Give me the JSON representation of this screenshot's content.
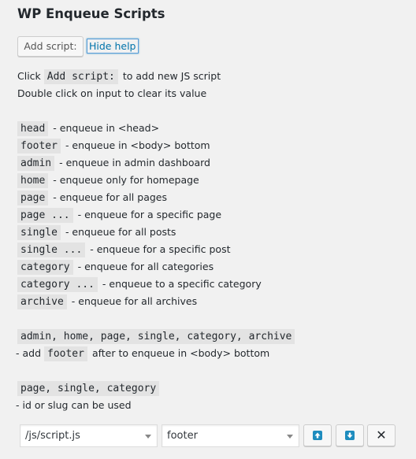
{
  "page": {
    "title": "WP Enqueue Scripts"
  },
  "toolbar": {
    "add_script_label": "Add script:",
    "hide_help_label": "Hide help"
  },
  "help": {
    "intro": [
      {
        "before": "Click ",
        "code": "Add script:",
        "after": " to add new JS script"
      },
      {
        "before": "Double click on input to clear its value",
        "code": "",
        "after": ""
      }
    ],
    "entries": [
      {
        "code": "head",
        "desc": " - enqueue in <head>"
      },
      {
        "code": "footer",
        "desc": " - enqueue in <body> bottom"
      },
      {
        "code": "admin",
        "desc": " - enqueue in admin dashboard"
      },
      {
        "code": "home",
        "desc": " - enqueue only for homepage"
      },
      {
        "code": "page",
        "desc": " - enqueue for all pages"
      },
      {
        "code": "page ...",
        "desc": " - enqueue for a specific page"
      },
      {
        "code": "single",
        "desc": " - enqueue for all posts"
      },
      {
        "code": "single ...",
        "desc": " - enqueue for a specific post"
      },
      {
        "code": "category",
        "desc": " - enqueue for all categories"
      },
      {
        "code": "category ...",
        "desc": " - enqueue to a specific category"
      },
      {
        "code": "archive",
        "desc": " - enqueue for all archives"
      }
    ],
    "footer_note": {
      "code": "admin, home, page, single, category, archive",
      "prefix": "- add ",
      "code2": "footer",
      "suffix": " after to enqueue in <body> bottom"
    },
    "id_note": {
      "code": "page, single, category",
      "text": "- id or slug can be used"
    }
  },
  "script_row": {
    "path_value": "/js/script.js",
    "location_value": "footer",
    "move_up_icon": "arrow-up-icon",
    "move_down_icon": "arrow-down-icon",
    "remove_icon": "close-icon",
    "remove_glyph": "✕"
  },
  "colors": {
    "background": "#f1f1f1",
    "link": "#0073aa",
    "accent": "#1e8cbe",
    "code_bg": "#e3e3e3"
  }
}
